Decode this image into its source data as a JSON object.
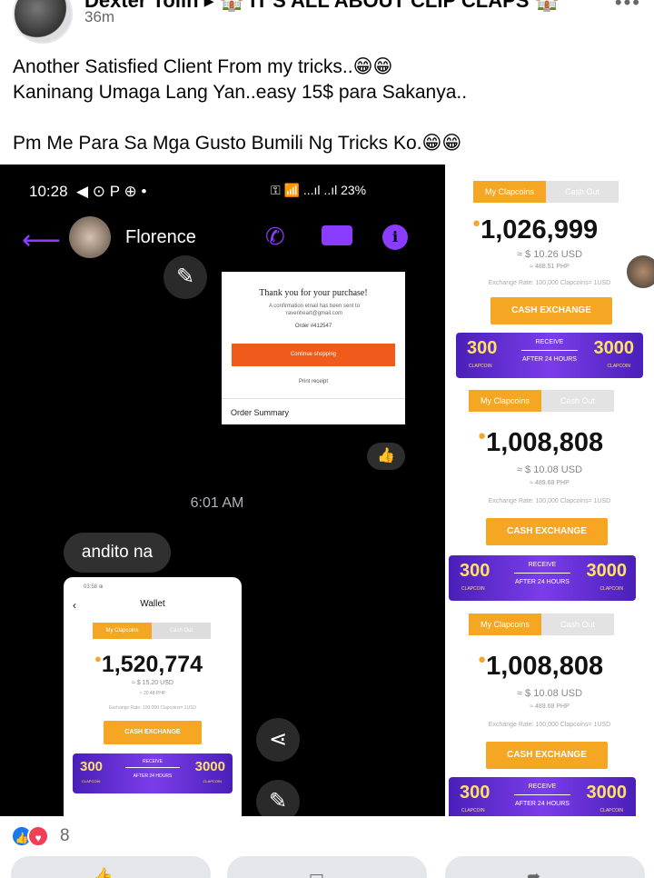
{
  "post": {
    "author": "Dexter Tolin",
    "group": "IT'S ALL ABOUT CLIP CLAPS",
    "time": "36m",
    "more_icon": "more-dots-icon",
    "caption_lines": [
      "Another Satisfied Client From my tricks..😁😁",
      "Kaninang Umaga Lang Yan..easy 15$ para Sakanya..",
      "Pm Me Para Sa Mga Gusto Bumili Ng Tricks Ko.😁😁"
    ]
  },
  "chat": {
    "status_time": "10:28",
    "status_icons": "◀ ⊙ P ⊕ •",
    "status_right": "⚿ 📶 ...ıl ..ıl 23%",
    "contact_name": "Florence",
    "receipt": {
      "thanks": "Thank you for your purchase!",
      "confirmation": "A confirmation email has been sent to ravenheart@gmail.com",
      "order": "Order #412547",
      "continue": "Continue shopping",
      "print": "Print receipt",
      "summary": "Order Summary"
    },
    "timestamp": "6:01 AM",
    "message": "andito na",
    "accent": "#8b3dff"
  },
  "wallet_screenshot": {
    "status": "03:58 ⊕",
    "title": "Wallet",
    "tab_active": "My Clapcoins",
    "tab_inactive": "Cash Out",
    "balance": "1,520,774",
    "usd": "≈ $ 15.20 USD",
    "php": "≈ 20.48 PHP",
    "rate": "Exchange Rate: 100,000 Clapcoins= 1USD",
    "button": "CASH EXCHANGE",
    "banner": {
      "left": "300",
      "right": "3000",
      "receive": "RECEIVE",
      "after": "AFTER 24 HOURS",
      "unit": "CLAPCOIN"
    }
  },
  "wallet_cards": [
    {
      "tab_active": "My Clapcoins",
      "tab_inactive": "Cash Out",
      "balance": "1,026,999",
      "usd": "≈ $ 10.26 USD",
      "php": "≈ 488.51 PHP",
      "rate": "Exchange Rate: 100,000 Clapcoins= 1USD",
      "button": "CASH EXCHANGE",
      "banner": {
        "left": "300",
        "right": "3000",
        "receive": "RECEIVE",
        "after": "AFTER 24 HOURS",
        "unit": "CLAPCOIN"
      }
    },
    {
      "tab_active": "My Clapcoins",
      "tab_inactive": "Cash Out",
      "balance": "1,008,808",
      "usd": "≈ $ 10.08 USD",
      "php": "≈ 489.68 PHP",
      "rate": "Exchange Rate: 100,000 Clapcoins= 1USD",
      "button": "CASH EXCHANGE",
      "banner": {
        "left": "300",
        "right": "3000",
        "receive": "RECEIVE",
        "after": "AFTER 24 HOURS",
        "unit": "CLAPCOIN"
      }
    },
    {
      "tab_active": "My Clapcoins",
      "tab_inactive": "Cash Out",
      "balance": "1,008,808",
      "usd": "≈ $ 10.08 USD",
      "php": "≈ 489.68 PHP",
      "rate": "Exchange Rate: 100,000 Clapcoins= 1USD",
      "button": "CASH EXCHANGE",
      "banner": {
        "left": "300",
        "right": "3000",
        "receive": "RECEIVE",
        "after": "AFTER 24 HOURS",
        "unit": "CLAPCOIN"
      }
    }
  ],
  "reactions": {
    "count": "8",
    "icons": [
      "like-icon",
      "love-icon"
    ]
  },
  "colors": {
    "facebook_blue": "#1877f2",
    "love_red": "#f33e58",
    "coin_orange": "#f5a623",
    "banner_purple": "#6a2fd8"
  }
}
